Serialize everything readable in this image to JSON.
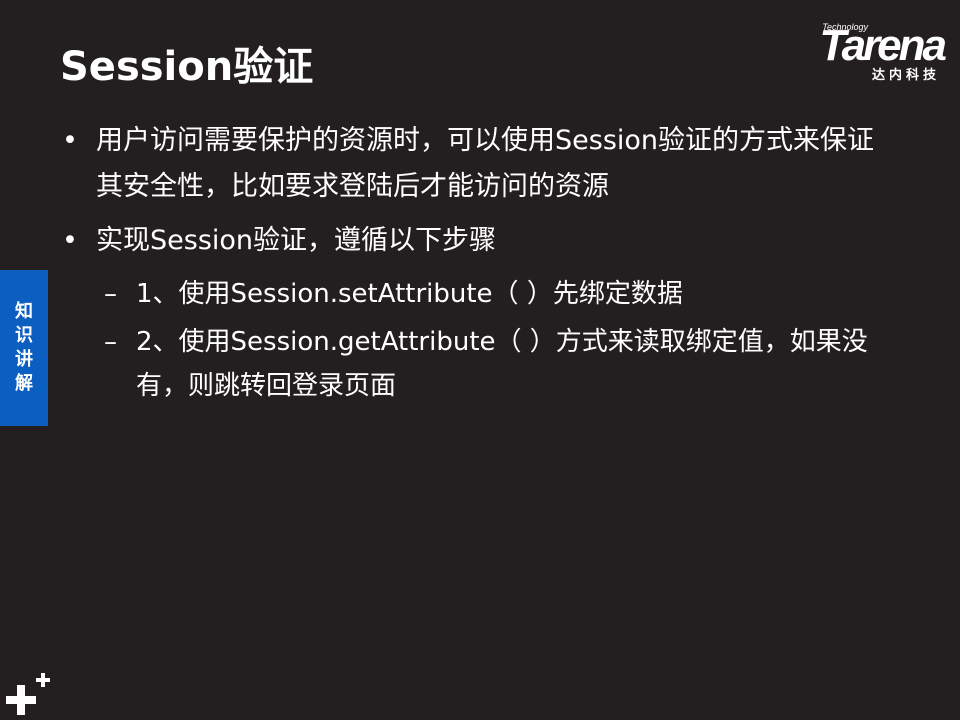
{
  "title": "Session验证",
  "logo": {
    "tech": "Technology",
    "word": "Tarena",
    "cn": "达内科技"
  },
  "side_tab": {
    "chars": [
      "知",
      "识",
      "讲",
      "解"
    ]
  },
  "bullets": [
    {
      "marker": "•",
      "text": "用户访问需要保护的资源时，可以使用Session验证的方式来保证其安全性，比如要求登陆后才能访问的资源"
    },
    {
      "marker": "•",
      "text": "实现Session验证，遵循以下步骤"
    }
  ],
  "sub_bullets": [
    {
      "marker": "–",
      "text": "1、使用Session.setAttribute（ ）先绑定数据"
    },
    {
      "marker": "–",
      "text": "2、使用Session.getAttribute（ ）方式来读取绑定值，如果没有，则跳转回登录页面"
    }
  ],
  "colors": {
    "background": "#231f20",
    "text": "#ffffff",
    "side_tab": "#0b5fc0"
  },
  "icons": {
    "corner": "plus-icon"
  }
}
